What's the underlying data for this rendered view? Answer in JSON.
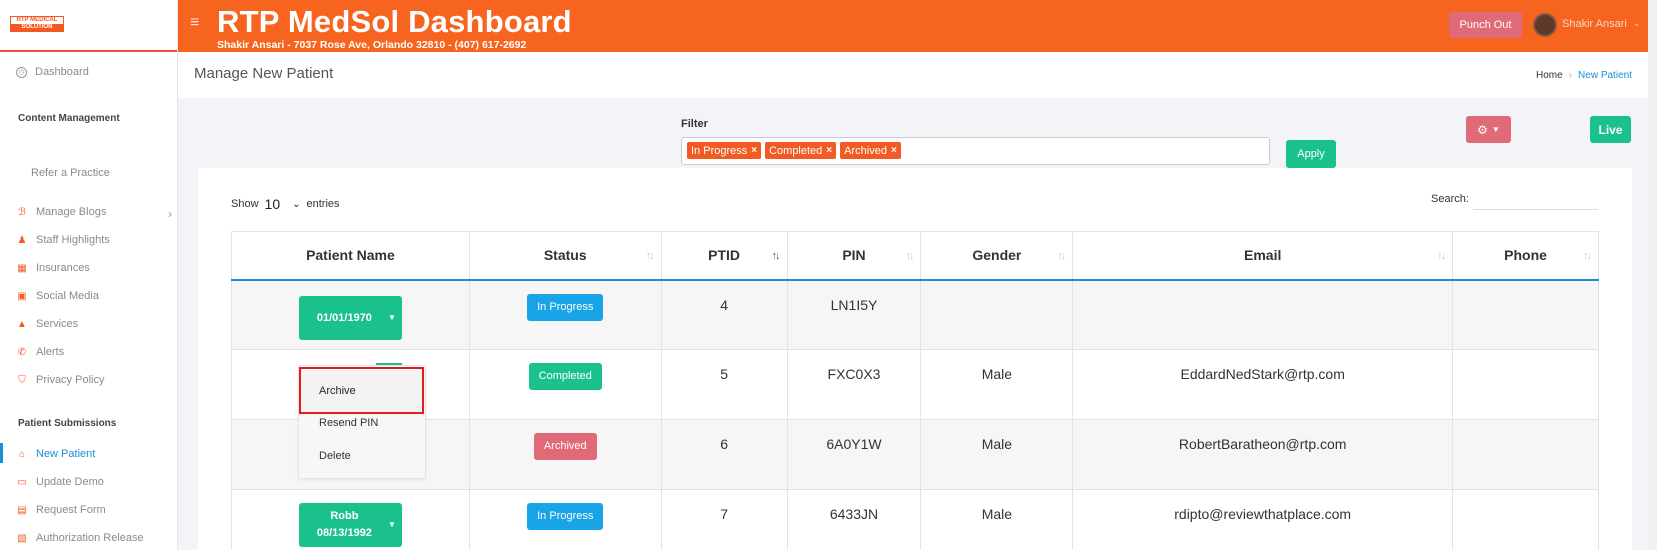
{
  "logo": {
    "line1": "RTP MEDICAL",
    "line2": "SOLUTION"
  },
  "sidebar": {
    "dashboard": "Dashboard",
    "content_heading": "Content Management",
    "refer": "Refer a Practice",
    "items": [
      {
        "label": "Manage Blogs",
        "icon": "blog-icon"
      },
      {
        "label": "Staff Highlights",
        "icon": "staff-icon"
      },
      {
        "label": "Insurances",
        "icon": "insurance-icon"
      },
      {
        "label": "Social Media",
        "icon": "social-icon"
      },
      {
        "label": "Services",
        "icon": "services-icon"
      },
      {
        "label": "Alerts",
        "icon": "phone-icon"
      },
      {
        "label": "Privacy Policy",
        "icon": "shield-icon"
      }
    ],
    "submissions_heading": "Patient Submissions",
    "submissions": [
      {
        "label": "New Patient",
        "icon": "home-icon"
      },
      {
        "label": "Update Demo",
        "icon": "id-card-icon"
      },
      {
        "label": "Request Form",
        "icon": "form-icon"
      },
      {
        "label": "Authorization Release",
        "icon": "release-icon"
      }
    ]
  },
  "header": {
    "title": "RTP MedSol Dashboard",
    "subtitle": "Shakir Ansari - 7037 Rose Ave, Orlando 32810 - (407) 617-2692",
    "punch_out": "Punch Out",
    "user": "Shakir Ansari"
  },
  "page": {
    "title": "Manage New Patient",
    "breadcrumb": [
      "Home",
      "New Patient"
    ]
  },
  "filter": {
    "label": "Filter",
    "chips": [
      "In Progress",
      "Completed",
      "Archived"
    ],
    "apply": "Apply",
    "live": "Live"
  },
  "table_controls": {
    "show": "Show",
    "entries_value": "10",
    "entries": "entries",
    "search": "Search:"
  },
  "table": {
    "headers": [
      "Patient Name",
      "Status",
      "PTID",
      "PIN",
      "Gender",
      "Email",
      "Phone"
    ],
    "rows": [
      {
        "name_line1": "",
        "name_line2": "01/01/1970",
        "status": "In Progress",
        "ptid": "4",
        "pin": "LN1I5Y",
        "gender": "",
        "email": "",
        "phone": ""
      },
      {
        "name_line1": "",
        "name_line2": "",
        "status": "Completed",
        "ptid": "5",
        "pin": "FXC0X3",
        "gender": "Male",
        "email": "EddardNedStark@rtp.com",
        "phone": ""
      },
      {
        "name_line1": "",
        "name_line2": "",
        "status": "Archived",
        "ptid": "6",
        "pin": "6A0Y1W",
        "gender": "Male",
        "email": "RobertBaratheon@rtp.com",
        "phone": ""
      },
      {
        "name_line1": "Robb",
        "name_line2": "08/13/1992",
        "status": "In Progress",
        "ptid": "7",
        "pin": "6433JN",
        "gender": "Male",
        "email": "rdipto@reviewthatplace.com",
        "phone": ""
      }
    ]
  },
  "menu": {
    "items": [
      "Archive",
      "Resend PIN",
      "Delete"
    ]
  },
  "colors": {
    "brand": "#f76420",
    "green": "#1bc18d",
    "blue": "#1aa4e8",
    "red": "#e06a78",
    "accent": "#1a8fd6"
  }
}
